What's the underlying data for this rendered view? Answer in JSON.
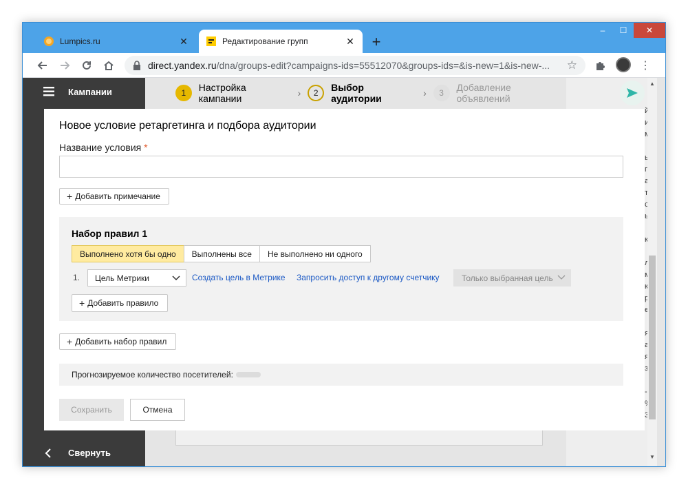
{
  "browser": {
    "tabs": [
      {
        "title": "Lumpics.ru",
        "close": "✕"
      },
      {
        "title": "Редактирование групп",
        "close": "✕"
      }
    ],
    "new_tab": "+",
    "url_host": "direct.yandex.ru",
    "url_rest": "/dna/groups-edit?campaigns-ids=55512070&groups-ids=&is-new=1&is-new-...",
    "window_controls": {
      "minimize": "–",
      "maximize": "☐",
      "close": "✕"
    }
  },
  "sidebar": {
    "top_label": "Кампании",
    "bottom_label": "Свернуть"
  },
  "steps": [
    {
      "num": "1",
      "label": "Настройка кампании"
    },
    {
      "num": "2",
      "label": "Выбор аудитории"
    },
    {
      "num": "3",
      "label": "Добавление объявлений"
    }
  ],
  "modal": {
    "title": "Новое условие ретаргетинга и подбора аудитории",
    "name_label": "Название условия",
    "required_mark": "*",
    "name_value": "",
    "add_note": "Добавить примечание",
    "ruleset": {
      "title": "Набор правил 1",
      "modes": [
        "Выполнено хотя бы одно",
        "Выполнены все",
        "Не выполнено ни одного"
      ],
      "selected_mode": "Выполнено хотя бы одно",
      "rule": {
        "number": "1.",
        "type": "Цель Метрики",
        "create_goal_link": "Создать цель в Метрике",
        "request_access_link": "Запросить доступ к другому счетчику",
        "goal_select": "Только выбранная цель"
      },
      "add_rule": "Добавить правило"
    },
    "add_ruleset": "Добавить набор правил",
    "forecast_label": "Прогнозируемое количество посетителей:",
    "save": "Сохранить",
    "cancel": "Отмена"
  },
  "colors": {
    "window_frame": "#4da3e8",
    "sidebar": "#3b3b3b",
    "selected_mode": "#ffeba0",
    "link": "#1a58c4",
    "step_active_ring": "#c9a100"
  },
  "side_letters": [
    "й",
    "и",
    "м",
    "",
    "ь",
    "г",
    "а",
    "т",
    "с",
    "ы",
    "",
    "к",
    "",
    "л",
    "м",
    "к",
    "р",
    "е",
    "",
    "я",
    "а",
    "я",
    "з",
    "",
    "-",
    "%",
    "3"
  ]
}
